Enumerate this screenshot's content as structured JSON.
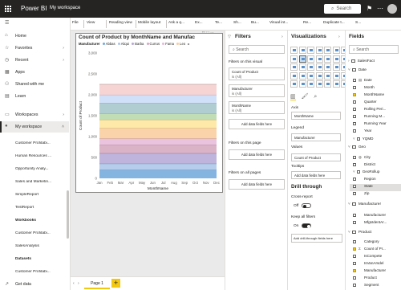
{
  "topbar": {
    "app_name": "Power BI",
    "workspace": "My workspace",
    "search_placeholder": "Search"
  },
  "nav": {
    "home": "Home",
    "favorites": "Favorites",
    "recent": "Recent",
    "apps": "Apps",
    "shared": "Shared with me",
    "learn": "Learn",
    "workspaces": "Workspaces",
    "my_workspace": "My workspace",
    "items": [
      "Customer Profitabi...",
      "Human Resources ...",
      "Opportunity Analy...",
      "Sales and Marketin...",
      "SimpleReport",
      "TestReport"
    ],
    "workbooks_heading": "Workbooks",
    "workbooks": [
      "Customer Profitabi...",
      "SalesAnalysis"
    ],
    "datasets_heading": "Datasets",
    "datasets": [
      "Customer Profitabi..."
    ],
    "get_data": "Get data"
  },
  "ribbon": {
    "file": "File",
    "view": "View",
    "reading_view": "Reading view",
    "mobile_layout": "Mobile layout",
    "ask_question": "Ask a q...",
    "explore": "Ex...",
    "text_box": "Te...",
    "shapes": "Sh...",
    "buttons": "Bu...",
    "visual_interactions": "Visual int...",
    "refresh": "Re...",
    "duplicate": "Duplicate t...",
    "save": "S..."
  },
  "visual": {
    "title": "Count of Product by MonthName and Manufac",
    "legend_title": "Manufacturer",
    "legend_items": [
      "Abbas",
      "Aliqui",
      "Barba",
      "Currus",
      "Fama",
      "Leo"
    ],
    "legend_more": "▸"
  },
  "chart_data": {
    "type": "area",
    "title": "Count of Product by MonthName and Manufac",
    "xlabel": "MonthName",
    "ylabel": "Count of Product",
    "categories": [
      "Jan",
      "Feb",
      "Mar",
      "Apr",
      "May",
      "Jun",
      "Jul",
      "Aug",
      "Sep",
      "Oct",
      "Nov",
      "Dec"
    ],
    "y_ticks": [
      "0",
      "500",
      "1,000",
      "1,500",
      "2,000",
      "2,500",
      "3,000"
    ],
    "ylim": [
      0,
      3000
    ],
    "stacked": true,
    "series": [
      {
        "name": "Abbas",
        "values": [
          200,
          200,
          200,
          200,
          200,
          200,
          200,
          200,
          200,
          200,
          200,
          200
        ]
      },
      {
        "name": "Aliqui",
        "values": [
          150,
          150,
          150,
          150,
          150,
          150,
          150,
          150,
          150,
          150,
          150,
          150
        ]
      },
      {
        "name": "Barba",
        "values": [
          250,
          250,
          250,
          250,
          250,
          250,
          250,
          250,
          250,
          250,
          250,
          250
        ]
      },
      {
        "name": "Currus",
        "values": [
          200,
          200,
          200,
          200,
          200,
          200,
          200,
          200,
          200,
          200,
          200,
          200
        ]
      },
      {
        "name": "Fama",
        "values": [
          150,
          150,
          150,
          150,
          150,
          150,
          150,
          150,
          150,
          150,
          150,
          150
        ]
      },
      {
        "name": "Leo",
        "values": [
          250,
          250,
          250,
          250,
          250,
          250,
          250,
          250,
          250,
          250,
          250,
          250
        ]
      },
      {
        "values": [
          200,
          200,
          200,
          200,
          200,
          200,
          200,
          200,
          200,
          200,
          200,
          200
        ]
      },
      {
        "values": [
          150,
          150,
          150,
          150,
          150,
          150,
          150,
          150,
          150,
          150,
          150,
          150
        ]
      },
      {
        "values": [
          250,
          250,
          250,
          250,
          250,
          250,
          250,
          250,
          250,
          250,
          250,
          250
        ]
      },
      {
        "values": [
          200,
          200,
          200,
          200,
          200,
          200,
          200,
          200,
          200,
          200,
          200,
          200
        ]
      },
      {
        "values": [
          250,
          250,
          250,
          250,
          250,
          250,
          250,
          250,
          250,
          250,
          250,
          250
        ]
      }
    ],
    "colors": [
      "#6fa8dc",
      "#a9c4e8",
      "#b4a7d6",
      "#d5a6bd",
      "#e6b8d8",
      "#f9cb9c",
      "#ffe599",
      "#b6d7a8",
      "#a2c4c9",
      "#c9daf8",
      "#f4cccc"
    ],
    "grid": false
  },
  "page": {
    "tab": "Page 1",
    "add": "+"
  },
  "filters": {
    "title": "Filters",
    "search_placeholder": "Search",
    "on_visual": "Filters on this visual",
    "visual_filters": [
      {
        "name": "Count of Product",
        "value": "is (All)"
      },
      {
        "name": "Manufacturer",
        "value": "is (All)"
      },
      {
        "name": "MonthName",
        "value": "is (All)"
      }
    ],
    "add_fields": "Add data fields here",
    "on_page": "Filters on this page",
    "on_all": "Filters on all pages"
  },
  "visualizations": {
    "title": "Visualizations",
    "axis_label": "Axis",
    "axis_value": "MonthName",
    "legend_label": "Legend",
    "legend_value": "Manufacturer",
    "values_label": "Values",
    "values_value": "Count of Product",
    "tooltips_label": "Tooltips",
    "tooltips_add": "Add data fields here",
    "drill_title": "Drill through",
    "cross_report": "Cross-report",
    "cross_report_state": "Off",
    "keep_filters": "Keep all filters",
    "keep_filters_state": "On",
    "drill_add": "Add drill-through fields here"
  },
  "fields": {
    "title": "Fields",
    "search_placeholder": "Search",
    "tables": [
      {
        "name": "SalesFact",
        "type": "table"
      },
      {
        "name": "Date",
        "type": "table",
        "expanded": true
      }
    ],
    "date_fields": [
      "Date",
      "Month",
      "MonthName",
      "Quarter",
      "Rolling Peri...",
      "Running M...",
      "Running Year",
      "Year",
      "YQMD"
    ],
    "geo": "Geo",
    "geo_fields": [
      "City",
      "District",
      "GeoRollup",
      "Region",
      "State",
      "Zip"
    ],
    "manufacturer_table": "Manufacturer",
    "manufacturer_fields": [
      "Manufacturer",
      "MfgsIdentAr..."
    ],
    "product_table": "Product",
    "product_fields": [
      "Category",
      "Count of Pr...",
      "IsCompete",
      "IsVanArsdel",
      "Manufacturer",
      "Product",
      "Segment"
    ]
  }
}
